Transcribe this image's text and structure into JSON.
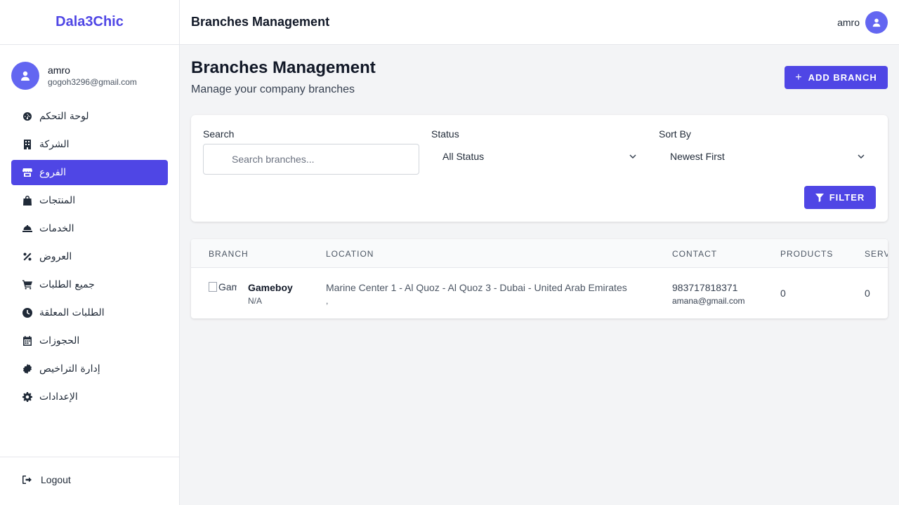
{
  "brand": "Dala3Chic",
  "user": {
    "name": "amro",
    "email": "gogoh3296@gmail.com"
  },
  "nav": [
    {
      "label": "لوحة التحكم",
      "icon": "dashboard-icon"
    },
    {
      "label": "الشركة",
      "icon": "building-icon"
    },
    {
      "label": "الفروع",
      "icon": "store-icon",
      "active": true
    },
    {
      "label": "المنتجات",
      "icon": "shopping-bag-icon"
    },
    {
      "label": "الخدمات",
      "icon": "service-bell-icon"
    },
    {
      "label": "العروض",
      "icon": "percent-icon"
    },
    {
      "label": "جميع الطلبات",
      "icon": "cart-icon"
    },
    {
      "label": "الطلبات المعلقة",
      "icon": "clock-icon"
    },
    {
      "label": "الحجوزات",
      "icon": "calendar-icon"
    },
    {
      "label": "إدارة التراخيص",
      "icon": "certificate-icon"
    },
    {
      "label": "الإعدادات",
      "icon": "gear-icon"
    }
  ],
  "logout_label": "Logout",
  "header": {
    "title": "Branches Management",
    "user_name": "amro"
  },
  "page": {
    "title": "Branches Management",
    "subtitle": "Manage your company branches",
    "add_button": "ADD BRANCH"
  },
  "filters": {
    "search_label": "Search",
    "search_placeholder": "Search branches...",
    "status_label": "Status",
    "status_value": "All Status",
    "sort_label": "Sort By",
    "sort_value": "Newest First",
    "filter_button": "FILTER"
  },
  "table": {
    "columns": [
      "BRANCH",
      "LOCATION",
      "CONTACT",
      "PRODUCTS",
      "SERVICES"
    ],
    "rows": [
      {
        "image_alt": "Gameboy",
        "name": "Gameboy",
        "code": "N/A",
        "location": "Marine Center 1 - Al Quoz - Al Quoz 3 - Dubai - United Arab Emirates",
        "location_extra": ",",
        "phone": "983717818371",
        "email": "amana@gmail.com",
        "products": "0",
        "services": "0"
      }
    ]
  },
  "colors": {
    "accent": "#4f46e5",
    "avatar": "#6366f1",
    "background": "#f3f4f6"
  }
}
